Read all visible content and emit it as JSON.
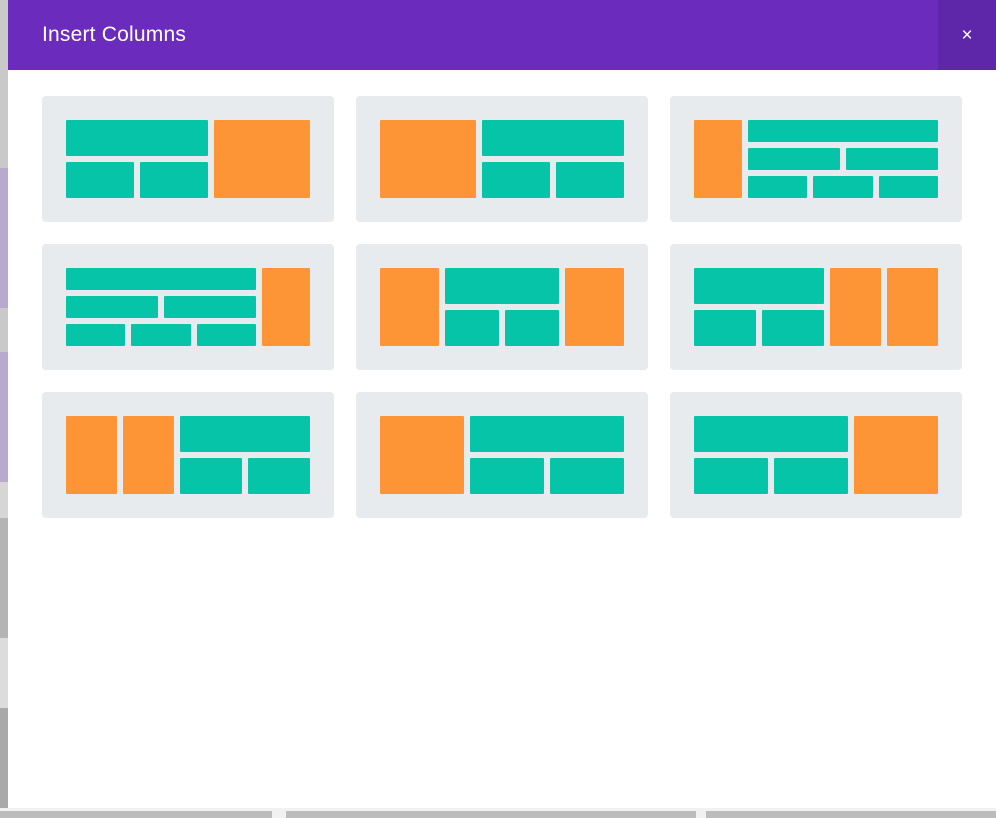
{
  "modal": {
    "title": "Insert Columns",
    "close_label": "×",
    "close_icon": "close-icon"
  },
  "theme": {
    "header_purple": "#6b2cbd",
    "close_purple": "#5e26a8",
    "card_bg": "#e8ebed",
    "block_teal": "#06c4a8",
    "block_orange": "#fd9436",
    "modal_bg": "#ffffff"
  },
  "layouts": [
    {
      "id": "layout-1",
      "name": "two-thirds-stack-left-third-right",
      "columns": [
        {
          "width": "2fr",
          "rows": [
            {
              "height": "1fr",
              "cells": [
                {
                  "color": "teal",
                  "width": "1fr"
                }
              ]
            },
            {
              "height": "1fr",
              "cells": [
                {
                  "color": "teal",
                  "width": "1fr"
                },
                {
                  "color": "teal",
                  "width": "1fr"
                }
              ]
            }
          ]
        },
        {
          "width": "1.35fr",
          "rows": [
            {
              "height": "1fr",
              "cells": [
                {
                  "color": "orange",
                  "width": "1fr"
                }
              ]
            }
          ]
        }
      ]
    },
    {
      "id": "layout-2",
      "name": "third-left-two-thirds-stack-right",
      "columns": [
        {
          "width": "1.35fr",
          "rows": [
            {
              "height": "1fr",
              "cells": [
                {
                  "color": "orange",
                  "width": "1fr"
                }
              ]
            }
          ]
        },
        {
          "width": "2fr",
          "rows": [
            {
              "height": "1fr",
              "cells": [
                {
                  "color": "teal",
                  "width": "1fr"
                }
              ]
            },
            {
              "height": "1fr",
              "cells": [
                {
                  "color": "teal",
                  "width": "1fr"
                },
                {
                  "color": "teal",
                  "width": "1fr"
                }
              ]
            }
          ]
        }
      ]
    },
    {
      "id": "layout-3",
      "name": "narrow-left-three-row-grid-right",
      "columns": [
        {
          "width": "0.85fr",
          "rows": [
            {
              "height": "1fr",
              "cells": [
                {
                  "color": "orange",
                  "width": "1fr"
                }
              ]
            }
          ]
        },
        {
          "width": "3.4fr",
          "rows": [
            {
              "height": "1fr",
              "cells": [
                {
                  "color": "teal",
                  "width": "1fr"
                }
              ]
            },
            {
              "height": "1fr",
              "cells": [
                {
                  "color": "teal",
                  "width": "1fr"
                },
                {
                  "color": "teal",
                  "width": "1fr"
                }
              ]
            },
            {
              "height": "1fr",
              "cells": [
                {
                  "color": "teal",
                  "width": "1fr"
                },
                {
                  "color": "teal",
                  "width": "1fr"
                },
                {
                  "color": "teal",
                  "width": "1fr"
                }
              ]
            }
          ]
        }
      ]
    },
    {
      "id": "layout-4",
      "name": "three-row-grid-left-narrow-right",
      "columns": [
        {
          "width": "3.4fr",
          "rows": [
            {
              "height": "1fr",
              "cells": [
                {
                  "color": "teal",
                  "width": "1fr"
                }
              ]
            },
            {
              "height": "1fr",
              "cells": [
                {
                  "color": "teal",
                  "width": "1fr"
                },
                {
                  "color": "teal",
                  "width": "1fr"
                }
              ]
            },
            {
              "height": "1fr",
              "cells": [
                {
                  "color": "teal",
                  "width": "1fr"
                },
                {
                  "color": "teal",
                  "width": "1fr"
                },
                {
                  "color": "teal",
                  "width": "1fr"
                }
              ]
            }
          ]
        },
        {
          "width": "0.85fr",
          "rows": [
            {
              "height": "1fr",
              "cells": [
                {
                  "color": "orange",
                  "width": "1fr"
                }
              ]
            }
          ]
        }
      ]
    },
    {
      "id": "layout-5",
      "name": "sidebar-left-stack-center-sidebar-right",
      "columns": [
        {
          "width": "1fr",
          "rows": [
            {
              "height": "1fr",
              "cells": [
                {
                  "color": "orange",
                  "width": "1fr"
                }
              ]
            }
          ]
        },
        {
          "width": "1.95fr",
          "rows": [
            {
              "height": "1fr",
              "cells": [
                {
                  "color": "teal",
                  "width": "1fr"
                }
              ]
            },
            {
              "height": "1fr",
              "cells": [
                {
                  "color": "teal",
                  "width": "1fr"
                },
                {
                  "color": "teal",
                  "width": "1fr"
                }
              ]
            }
          ]
        },
        {
          "width": "1fr",
          "rows": [
            {
              "height": "1fr",
              "cells": [
                {
                  "color": "orange",
                  "width": "1fr"
                }
              ]
            }
          ]
        }
      ]
    },
    {
      "id": "layout-6",
      "name": "stack-left-two-sidebars-right",
      "columns": [
        {
          "width": "2fr",
          "rows": [
            {
              "height": "1fr",
              "cells": [
                {
                  "color": "teal",
                  "width": "1fr"
                }
              ]
            },
            {
              "height": "1fr",
              "cells": [
                {
                  "color": "teal",
                  "width": "1fr"
                },
                {
                  "color": "teal",
                  "width": "1fr"
                }
              ]
            }
          ]
        },
        {
          "width": "0.78fr",
          "rows": [
            {
              "height": "1fr",
              "cells": [
                {
                  "color": "orange",
                  "width": "1fr"
                }
              ]
            }
          ]
        },
        {
          "width": "0.78fr",
          "rows": [
            {
              "height": "1fr",
              "cells": [
                {
                  "color": "orange",
                  "width": "1fr"
                }
              ]
            }
          ]
        }
      ]
    },
    {
      "id": "layout-7",
      "name": "two-sidebars-left-stack-right",
      "columns": [
        {
          "width": "0.78fr",
          "rows": [
            {
              "height": "1fr",
              "cells": [
                {
                  "color": "orange",
                  "width": "1fr"
                }
              ]
            }
          ]
        },
        {
          "width": "0.78fr",
          "rows": [
            {
              "height": "1fr",
              "cells": [
                {
                  "color": "orange",
                  "width": "1fr"
                }
              ]
            }
          ]
        },
        {
          "width": "2fr",
          "rows": [
            {
              "height": "1fr",
              "cells": [
                {
                  "color": "teal",
                  "width": "1fr"
                }
              ]
            },
            {
              "height": "1fr",
              "cells": [
                {
                  "color": "teal",
                  "width": "1fr"
                },
                {
                  "color": "teal",
                  "width": "1fr"
                }
              ]
            }
          ]
        }
      ]
    },
    {
      "id": "layout-8",
      "name": "wide-sidebar-left-stack-right",
      "columns": [
        {
          "width": "1.2fr",
          "rows": [
            {
              "height": "1fr",
              "cells": [
                {
                  "color": "orange",
                  "width": "1fr"
                }
              ]
            }
          ]
        },
        {
          "width": "2.2fr",
          "rows": [
            {
              "height": "1fr",
              "cells": [
                {
                  "color": "teal",
                  "width": "1fr"
                }
              ]
            },
            {
              "height": "1fr",
              "cells": [
                {
                  "color": "teal",
                  "width": "1fr"
                },
                {
                  "color": "teal",
                  "width": "1fr"
                }
              ]
            }
          ]
        }
      ]
    },
    {
      "id": "layout-9",
      "name": "stack-left-wide-sidebar-right",
      "columns": [
        {
          "width": "2.2fr",
          "rows": [
            {
              "height": "1fr",
              "cells": [
                {
                  "color": "teal",
                  "width": "1fr"
                }
              ]
            },
            {
              "height": "1fr",
              "cells": [
                {
                  "color": "teal",
                  "width": "1fr"
                },
                {
                  "color": "teal",
                  "width": "1fr"
                }
              ]
            }
          ]
        },
        {
          "width": "1.2fr",
          "rows": [
            {
              "height": "1fr",
              "cells": [
                {
                  "color": "orange",
                  "width": "1fr"
                }
              ]
            }
          ]
        }
      ]
    }
  ]
}
